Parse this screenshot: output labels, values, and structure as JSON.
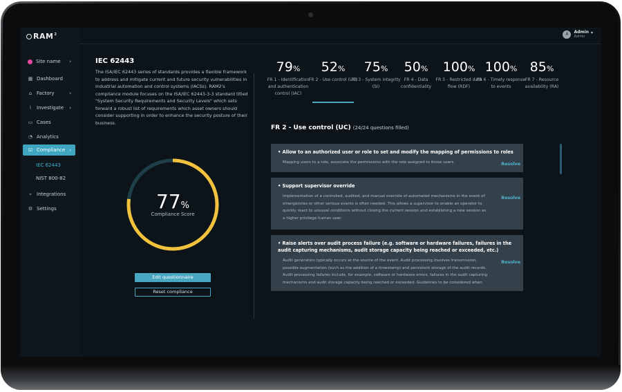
{
  "app": {
    "logo": "RAM",
    "logo_mark": "2"
  },
  "user": {
    "initial": "A",
    "name": "Admin",
    "role": "Admin"
  },
  "sidebar": {
    "site": "Site name",
    "items": [
      {
        "label": "Dashboard",
        "icon": "grid-icon"
      },
      {
        "label": "Factory",
        "icon": "factory-icon"
      },
      {
        "label": "Investigate",
        "icon": "chart-line-icon"
      },
      {
        "label": "Cases",
        "icon": "folder-icon"
      },
      {
        "label": "Analytics",
        "icon": "analytics-icon"
      },
      {
        "label": "Compliance",
        "icon": "checklist-icon"
      },
      {
        "label": "Integrations",
        "icon": "plug-icon"
      },
      {
        "label": "Settings",
        "icon": "gear-icon"
      }
    ],
    "compliance_sub": [
      "IEC 62443",
      "NIST 800-82"
    ]
  },
  "standard": {
    "title": "IEC 62443",
    "description": "The ISA/IEC 62443 series of standards provides a flexible framework to address and mitigate current and future security vulnerabilities in industrial automation and control systems (IACSs). RAM2's compliance module focuses on the ISA/IEC 62443-3-3 standard titled \"System Security Requirements and Security Levels\" which sets forward a robust list of requirements which asset owners should consider supporting in order to enhance the security posture of their business."
  },
  "score": {
    "value": 77,
    "unit": "%",
    "label": "Compliance Score",
    "fraction": 0.77
  },
  "buttons": {
    "edit": "Edit questionnaire",
    "reset": "Reset compliance"
  },
  "frs": [
    {
      "value": "79",
      "label": "FR 1 - Identification and authentication control (IAC)"
    },
    {
      "value": "52",
      "label": "FR 2 - Use control (UC)"
    },
    {
      "value": "75",
      "label": "FR 3 - System integrity (SI)"
    },
    {
      "value": "50",
      "label": "FR 4 - Data confidentiality"
    },
    {
      "value": "100",
      "label": "FR 5 - Restricted data flow (RDF)"
    },
    {
      "value": "100",
      "label": "FR 6 - Timely response to events"
    },
    {
      "value": "85",
      "label": "FR 7 - Resource availability (RA)"
    }
  ],
  "pct_unit": "%",
  "section": {
    "title": "FR 2 - Use control (UC)",
    "count": "(24/24 questions filled)"
  },
  "requirements": [
    {
      "title": "• Allow to an authorized user or role to set and modify the mapping of permissions to roles",
      "body": "Mapping users to a role, associate the permissions with the role assigned to those users.",
      "action": "Resolve"
    },
    {
      "title": "• Support supervisor override",
      "body": "Implementation of a controlled, audited, and manual override of automated mechanisms in the event of emergencies or other serious events is often needed. This allows a supervisor to enable an operator to quickly react to unusual conditions without closing the current session and establishing a new session as a higher privilege human user.",
      "action": "Resolve"
    },
    {
      "title": "• Raise alerts over audit process failure (e.g. software or hardware failures, failures in the audit capturing mechanisms, audit storage capacity being reached or exceeded, etc.)",
      "body": "Audit generation typically occurs at the source of the event. Audit processing involves transmission, possible augmentation (such as the addition of a timestamp) and persistent storage of the audit records. Audit processing failures include, for example, software or hardware errors, failures in the audit capturing mechanisms and audit storage capacity being reached or exceeded. Guidelines to be considered when",
      "action": "Resolve"
    }
  ],
  "colors": {
    "accent": "#3fa6c1",
    "gauge_fill": "#f2c23d",
    "gauge_track": "#1e3f4a",
    "site_dot": "#e64aa0"
  }
}
